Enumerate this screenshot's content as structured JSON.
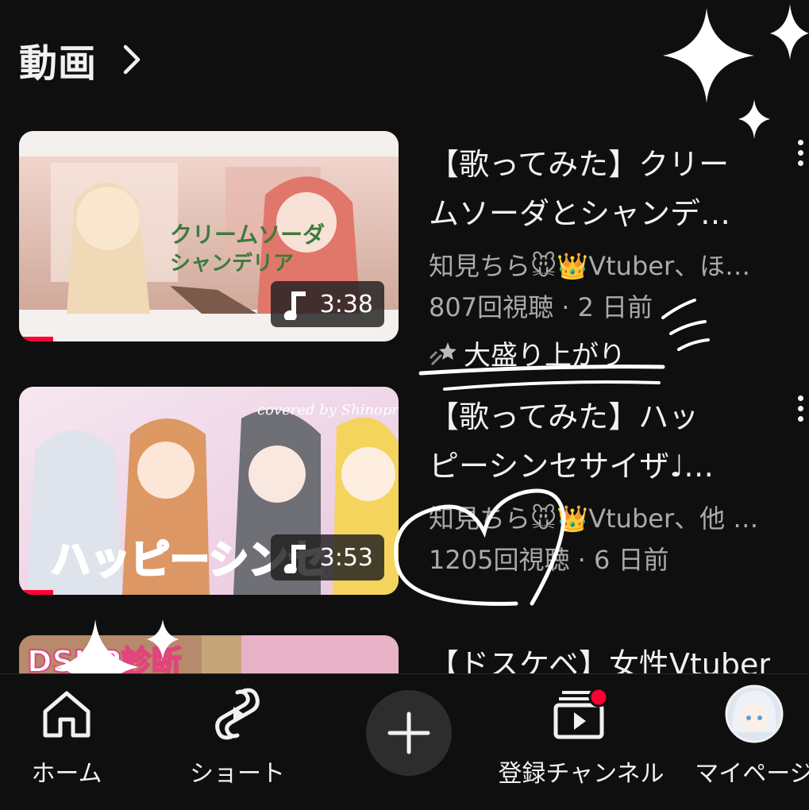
{
  "section": {
    "title": "動画"
  },
  "videos": [
    {
      "title_line1": "【歌ってみた】クリー",
      "title_line2": "ムソーダとシャンデ…",
      "channel": "知見ちら🐭👑Vtuber、ほ…",
      "views": "807回視聴",
      "age": "2 日前",
      "badge": "大盛り上がり",
      "duration": "3:38",
      "thumb_text": "クリームソーダとシャンデリア",
      "progress": 0.09
    },
    {
      "title_line1": "【歌ってみた】ハッ",
      "title_line2": "ピーシンセサイザ♩…",
      "channel": "知見ちら🐭👑Vtuber、他 …",
      "views": "1205回視聴",
      "age": "6 日前",
      "duration": "3:53",
      "thumb_text": "ハッピーシンセ",
      "thumb_credit": "covered by Shinopro",
      "progress": 0.09
    },
    {
      "title_line1": "【ドスケベ】女性Vtuber",
      "thumb_text": "DSHP診断"
    }
  ],
  "nav": {
    "home": "ホーム",
    "shorts": "ショート",
    "subscriptions": "登録チャンネル",
    "mypage": "マイページ"
  },
  "colors": {
    "background": "#0f0f0f",
    "accent": "#ff0033",
    "secondary_text": "#aaaaaa"
  }
}
